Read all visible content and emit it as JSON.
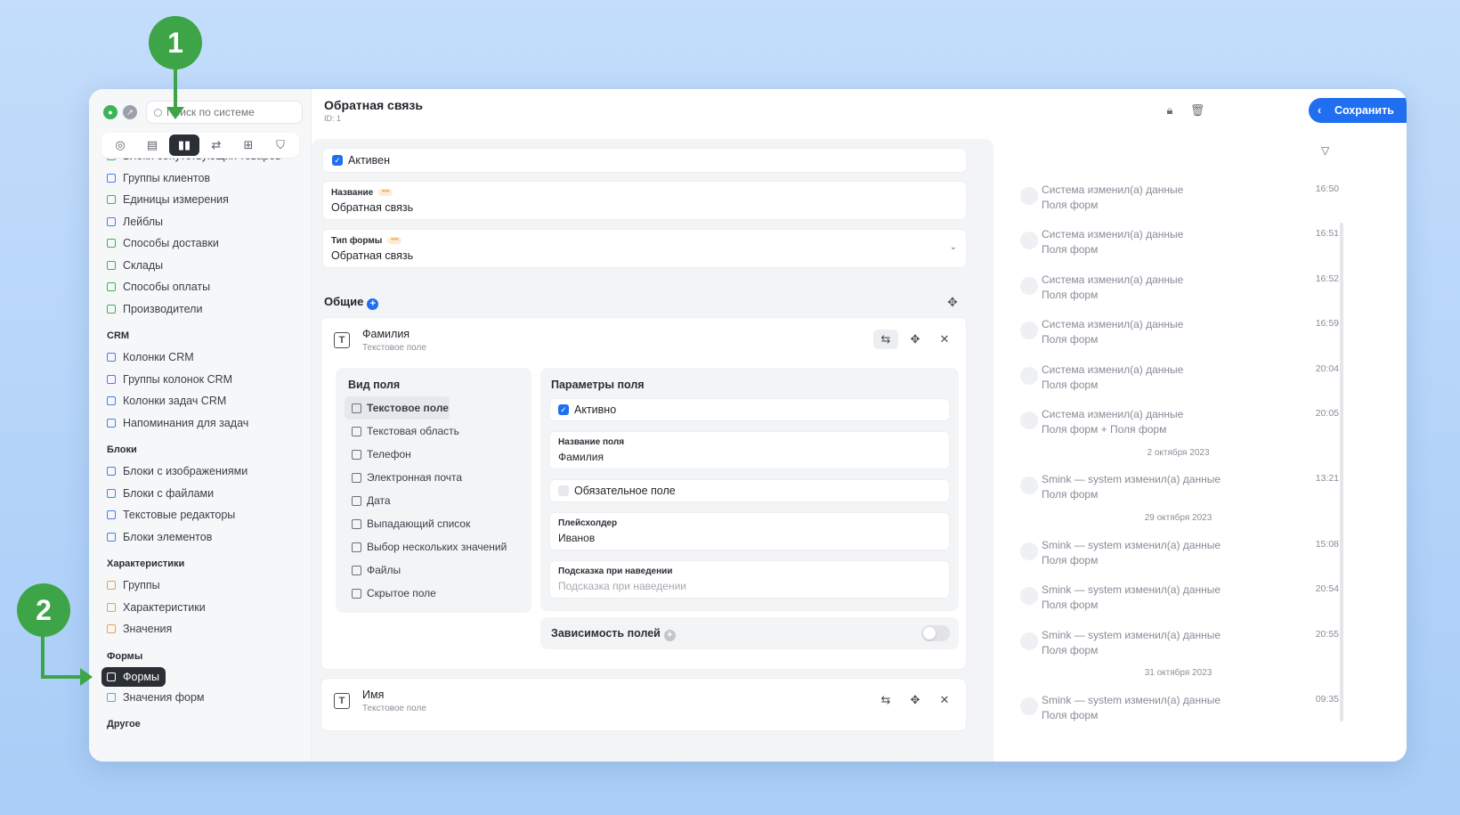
{
  "sidebar": {
    "search_placeholder": "Поиск по системе",
    "nav_icons": [
      "dashboard-icon",
      "catalog-icon",
      "reference-icon",
      "settings-icon",
      "add-icon",
      "widget-icon"
    ],
    "items_top": [
      {
        "label": "Блоки сопутствующих товаров",
        "color": "#3cb55a"
      },
      {
        "label": "Группы клиентов",
        "color": "#4a7df0"
      },
      {
        "label": "Единицы измерения",
        "color": "#3cb55a"
      },
      {
        "label": "Лейблы",
        "color": "#4a7df0"
      },
      {
        "label": "Способы доставки",
        "color": "#3cb55a"
      },
      {
        "label": "Склады",
        "color": "#3cb55a"
      },
      {
        "label": "Способы оплаты",
        "color": "#3cb55a"
      },
      {
        "label": "Производители",
        "color": "#3cb55a"
      }
    ],
    "crm_head": "CRM",
    "crm_items": [
      {
        "label": "Колонки CRM",
        "color": "#4a7df0"
      },
      {
        "label": "Группы колонок CRM",
        "color": "#4a7df0"
      },
      {
        "label": "Колонки задач CRM",
        "color": "#4a7df0"
      },
      {
        "label": "Напоминания для задач",
        "color": "#4a7df0"
      }
    ],
    "blocks_head": "Блоки",
    "blocks_items": [
      {
        "label": "Блоки с изображениями",
        "color": "#4a7df0"
      },
      {
        "label": "Блоки с файлами",
        "color": "#4a7df0"
      },
      {
        "label": "Текстовые редакторы",
        "color": "#4a7df0"
      },
      {
        "label": "Блоки элементов",
        "color": "#4a7df0"
      }
    ],
    "chars_head": "Характеристики",
    "chars_items": [
      {
        "label": "Группы",
        "color": "#f0a040"
      },
      {
        "label": "Характеристики",
        "color": "#f0a040"
      },
      {
        "label": "Значения",
        "color": "#f0a040"
      }
    ],
    "forms_head": "Формы",
    "forms_selected": "Формы",
    "forms_items": [
      {
        "label": "Значения форм",
        "color": "#4ab0e0"
      }
    ],
    "other_head": "Другое"
  },
  "header": {
    "title": "Обратная связь",
    "id": "ID: 1",
    "save_label": "Сохранить"
  },
  "form": {
    "active_label": "Активен",
    "name_label": "Название",
    "name_value": "Обратная связь",
    "type_label": "Тип формы",
    "type_value": "Обратная связь"
  },
  "general": {
    "title": "Общие",
    "field1": {
      "name": "Фамилия",
      "type": "Текстовое поле"
    },
    "view_title": "Вид поля",
    "view_types": [
      "Текстовое поле",
      "Текстовая область",
      "Телефон",
      "Электронная почта",
      "Дата",
      "Выпадающий список",
      "Выбор нескольких значений",
      "Файлы",
      "Скрытое поле"
    ],
    "params_title": "Параметры поля",
    "param_active": "Активно",
    "param_name_label": "Название поля",
    "param_name_value": "Фамилия",
    "param_required": "Обязательное поле",
    "param_placeholder_label": "Плейсхолдер",
    "param_placeholder_value": "Иванов",
    "param_hint_label": "Подсказка при наведении",
    "param_hint_placeholder": "Подсказка при наведении",
    "dependency_label": "Зависимость полей",
    "field2": {
      "name": "Имя",
      "type": "Текстовое поле"
    }
  },
  "history": {
    "entries": [
      {
        "l1": "Система изменил(а) данные",
        "l2": "Поля форм",
        "time": "16:50"
      },
      {
        "l1": "Система изменил(а) данные",
        "l2": "Поля форм",
        "time": "16:51"
      },
      {
        "l1": "Система изменил(а) данные",
        "l2": "Поля форм",
        "time": "16:52"
      },
      {
        "l1": "Система изменил(а) данные",
        "l2": "Поля форм",
        "time": "16:59"
      },
      {
        "l1": "Система изменил(а) данные",
        "l2": "Поля форм",
        "time": "20:04"
      },
      {
        "l1": "Система изменил(а) данные",
        "l2": "Поля форм + Поля форм",
        "time": "20:05"
      },
      {
        "l1": "Smink — system изменил(а) данные",
        "l2": "Поля форм",
        "time": "13:21"
      },
      {
        "l1": "Smink — system изменил(а) данные",
        "l2": "Поля форм",
        "time": "15:08"
      },
      {
        "l1": "Smink — system изменил(а) данные",
        "l2": "Поля форм",
        "time": "20:54"
      },
      {
        "l1": "Smink — system изменил(а) данные",
        "l2": "Поля форм",
        "time": "20:55"
      },
      {
        "l1": "Smink — system изменил(а) данные",
        "l2": "Поля форм",
        "time": "09:35"
      }
    ],
    "dates": [
      "2 октября 2023",
      "29 октября 2023",
      "31 октября 2023"
    ]
  },
  "annotations": {
    "badge1": "1",
    "badge2": "2",
    "color": "#3da548"
  }
}
